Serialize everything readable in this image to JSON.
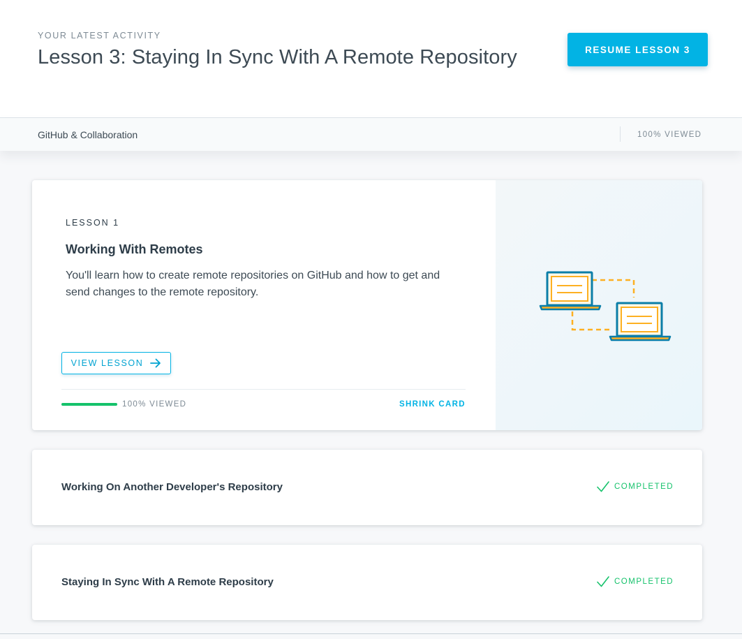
{
  "header": {
    "kicker": "YOUR LATEST ACTIVITY",
    "title": "Lesson 3: Staying In Sync With A Remote Repository",
    "resume_label": "RESUME LESSON 3"
  },
  "subbar": {
    "course": "GitHub & Collaboration",
    "viewed": "100% VIEWED"
  },
  "expanded_card": {
    "lesson_num": "LESSON 1",
    "title": "Working With Remotes",
    "description": "You'll learn how to create remote repositories on GitHub and how to get and send changes to the remote repository.",
    "view_label": "VIEW LESSON",
    "progress": 1.0,
    "progress_label": "100% VIEWED",
    "shrink_label": "SHRINK CARD"
  },
  "lessons": [
    {
      "title": "Working On Another Developer's Repository",
      "status": "COMPLETED"
    },
    {
      "title": "Staying In Sync With A Remote Repository",
      "status": "COMPLETED"
    }
  ],
  "colors": {
    "accent": "#02b3e4",
    "success": "#15c26b",
    "laptop": "#0b7ea8",
    "screen_lines": "#fdb022"
  },
  "icons": {
    "view_arrow": "arrow-right-icon",
    "status_check": "checkmark-icon",
    "illustration": "connected-laptops-illustration"
  }
}
